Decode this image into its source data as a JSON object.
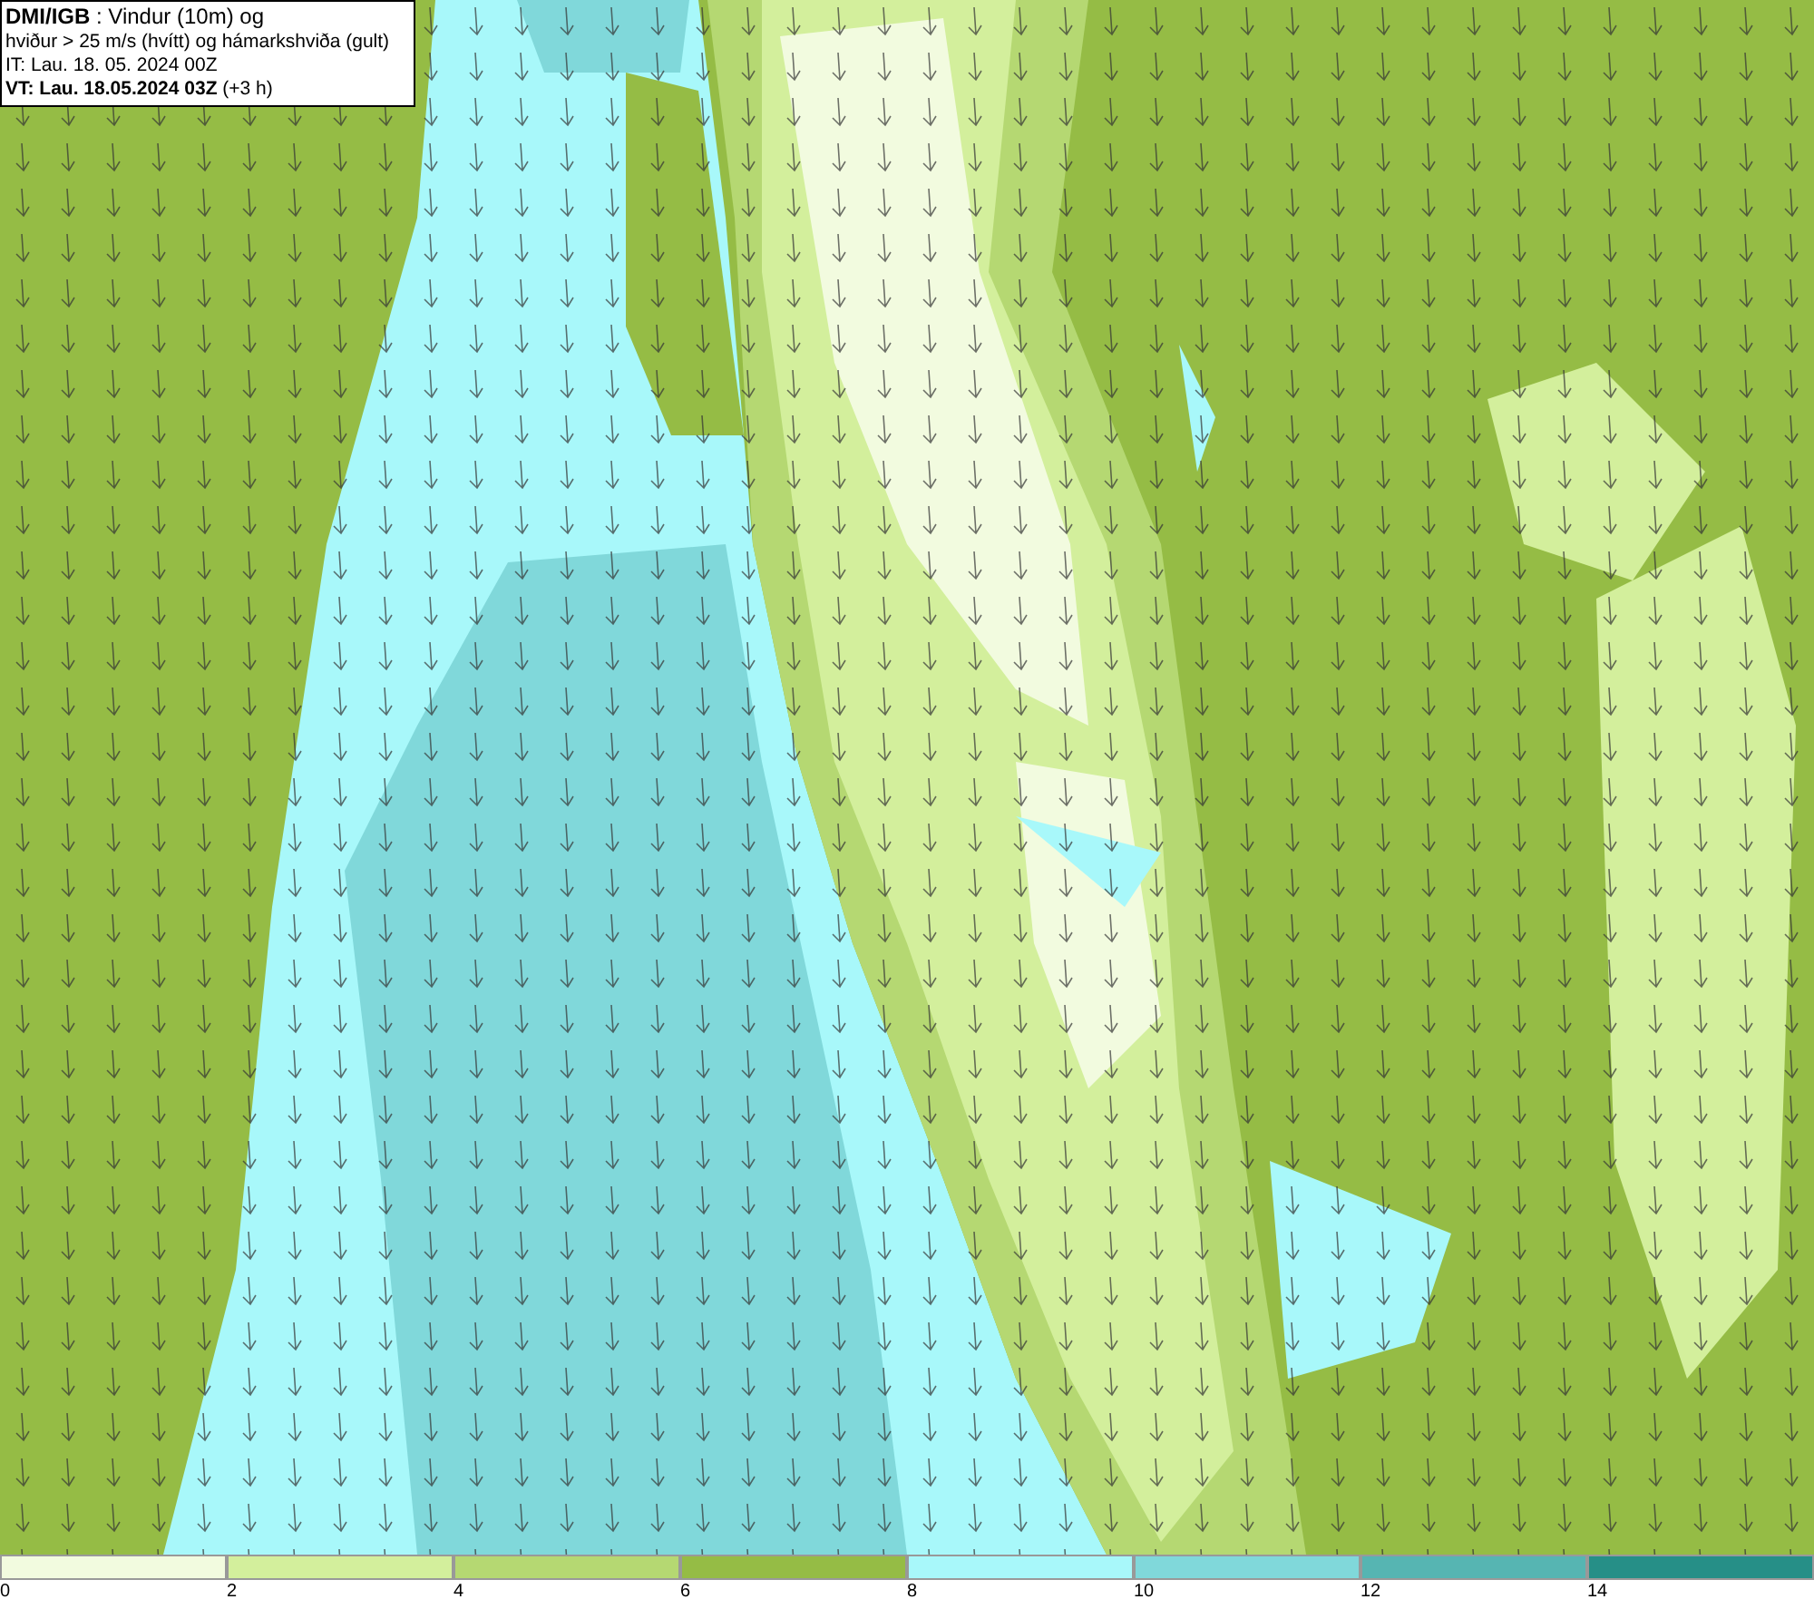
{
  "header": {
    "title": "**DMI/IGB** : Vindur (10m) og",
    "subtitle": "hviður > 25 m/s (hvítt) og hámarkshviða (gult)",
    "init_time": "IT: Lau. 18. 05. 2024 00Z",
    "valid_time": "**VT: Lau. 18.05.2024 03Z** (+3 h)"
  },
  "legend": [
    {
      "label": "0",
      "color": "#f2fbdf"
    },
    {
      "label": "2",
      "color": "#d3ef9c"
    },
    {
      "label": "4",
      "color": "#b5d872"
    },
    {
      "label": "6",
      "color": "#95bc45"
    },
    {
      "label": "8",
      "color": "#a8f8fa"
    },
    {
      "label": "10",
      "color": "#80d8da"
    },
    {
      "label": "12",
      "color": "#56b5b2"
    },
    {
      "label": "14",
      "color": "#268f87"
    }
  ]
}
